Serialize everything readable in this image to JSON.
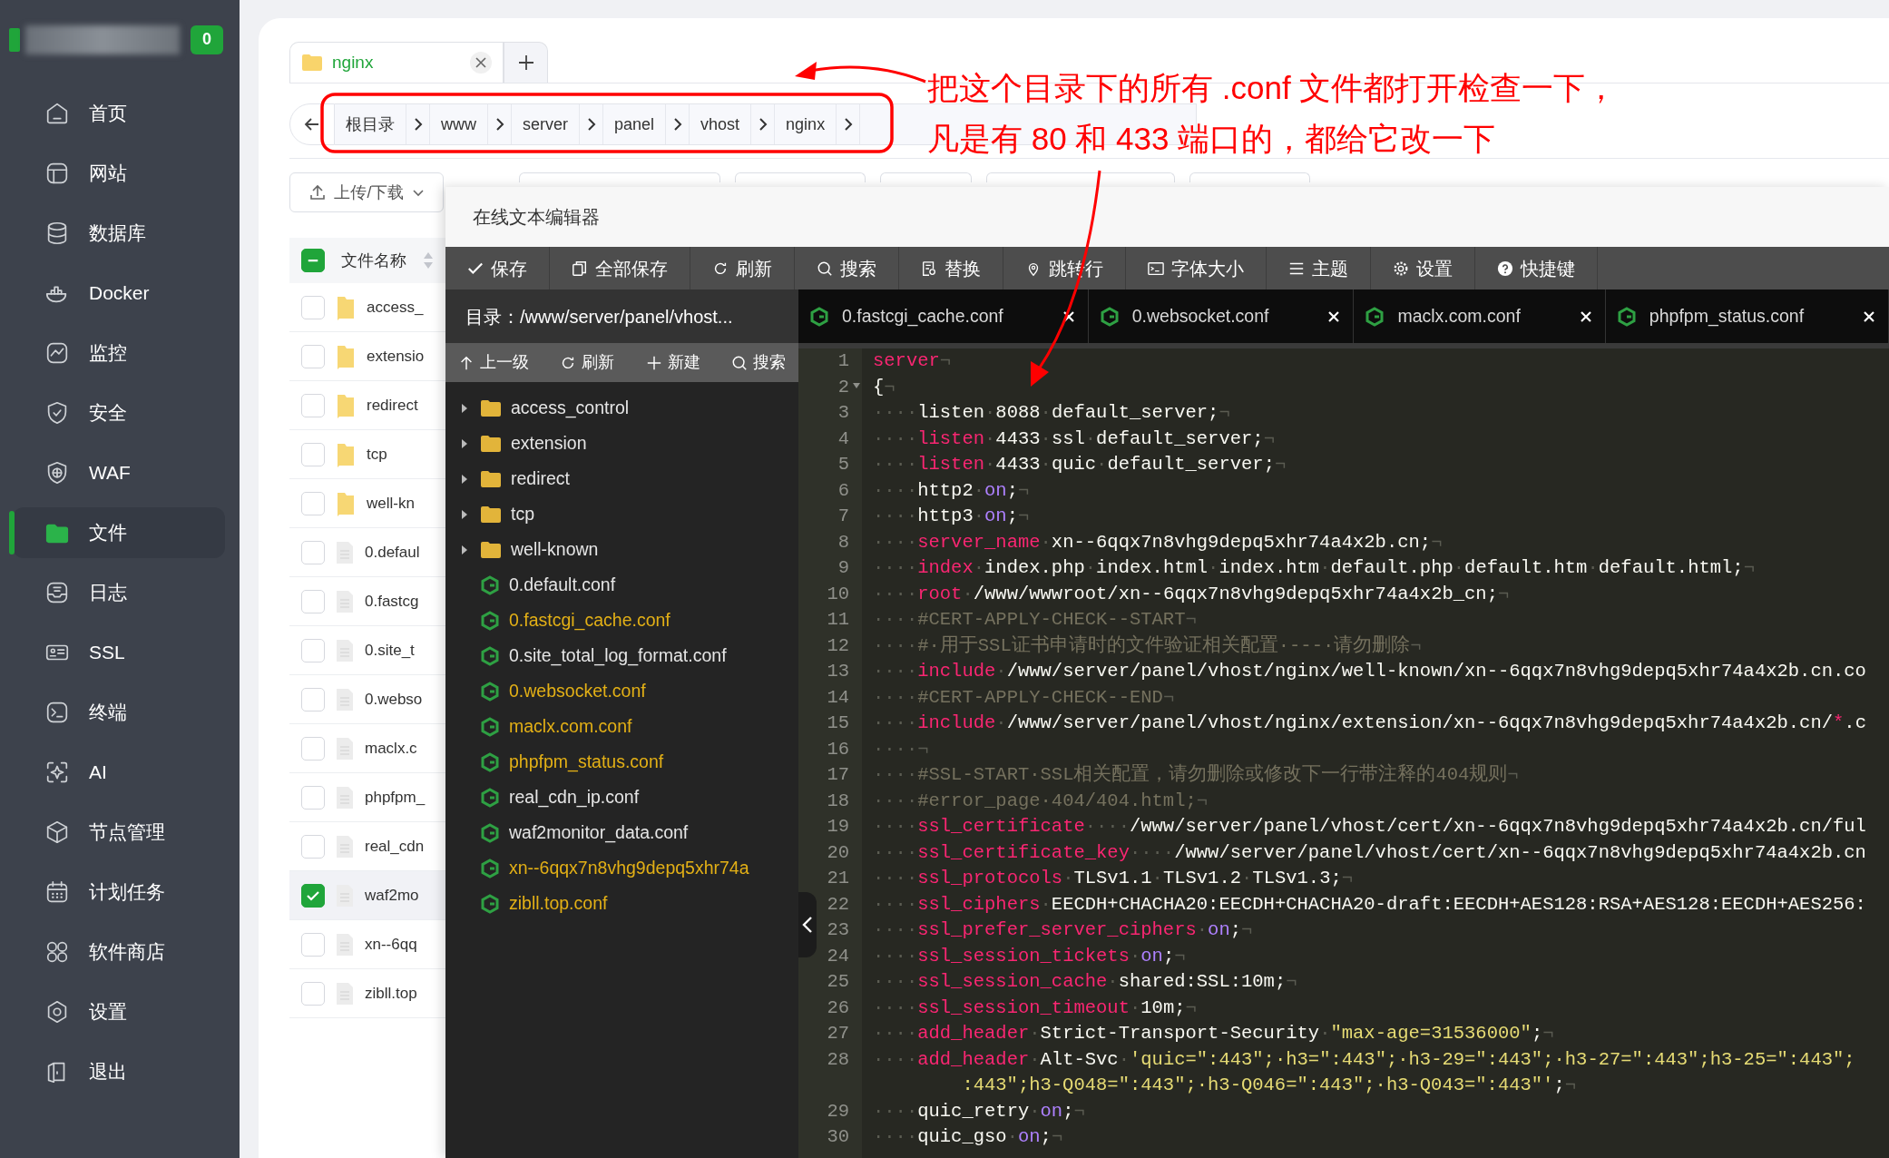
{
  "sidebar": {
    "badge": "0",
    "items": [
      {
        "label": "首页",
        "selected": false
      },
      {
        "label": "网站",
        "selected": false
      },
      {
        "label": "数据库",
        "selected": false
      },
      {
        "label": "Docker",
        "selected": false
      },
      {
        "label": "监控",
        "selected": false
      },
      {
        "label": "安全",
        "selected": false
      },
      {
        "label": "WAF",
        "selected": false
      },
      {
        "label": "文件",
        "selected": true
      },
      {
        "label": "日志",
        "selected": false
      },
      {
        "label": "SSL",
        "selected": false
      },
      {
        "label": "终端",
        "selected": false
      },
      {
        "label": "AI",
        "selected": false
      },
      {
        "label": "节点管理",
        "selected": false
      },
      {
        "label": "计划任务",
        "selected": false
      },
      {
        "label": "软件商店",
        "selected": false
      },
      {
        "label": "设置",
        "selected": false
      },
      {
        "label": "退出",
        "selected": false
      }
    ]
  },
  "file_tab": {
    "label": "nginx"
  },
  "breadcrumb": [
    "根目录",
    "www",
    "server",
    "panel",
    "vhost",
    "nginx"
  ],
  "upload_button": "上传/下载",
  "file_list": {
    "header": "文件名称",
    "header_indeterminate": true,
    "rows": [
      {
        "name": "access_",
        "kind": "folder",
        "checked": false
      },
      {
        "name": "extensio",
        "kind": "folder",
        "checked": false
      },
      {
        "name": "redirect",
        "kind": "folder",
        "checked": false
      },
      {
        "name": "tcp",
        "kind": "folder",
        "checked": false
      },
      {
        "name": "well-kn",
        "kind": "folder",
        "checked": false
      },
      {
        "name": "0.defaul",
        "kind": "file",
        "checked": false
      },
      {
        "name": "0.fastcg",
        "kind": "file",
        "checked": false
      },
      {
        "name": "0.site_t",
        "kind": "file",
        "checked": false
      },
      {
        "name": "0.webso",
        "kind": "file",
        "checked": false
      },
      {
        "name": "maclx.c",
        "kind": "file",
        "checked": false
      },
      {
        "name": "phpfpm_",
        "kind": "file",
        "checked": false
      },
      {
        "name": "real_cdn",
        "kind": "file",
        "checked": false
      },
      {
        "name": "waf2mo",
        "kind": "file",
        "checked": true
      },
      {
        "name": "xn--6qq",
        "kind": "file",
        "checked": false
      },
      {
        "name": "zibll.top",
        "kind": "file",
        "checked": false
      }
    ]
  },
  "editor": {
    "title": "在线文本编辑器",
    "toolbar": [
      {
        "label": "保存"
      },
      {
        "label": "全部保存"
      },
      {
        "label": "刷新"
      },
      {
        "label": "搜索"
      },
      {
        "label": "替换"
      },
      {
        "label": "跳转行"
      },
      {
        "label": "字体大小"
      },
      {
        "label": "主题"
      },
      {
        "label": "设置"
      },
      {
        "label": "快捷键"
      }
    ],
    "tree": {
      "path": "目录：/www/server/panel/vhost...",
      "actions": [
        {
          "label": "上一级"
        },
        {
          "label": "刷新"
        },
        {
          "label": "新建"
        },
        {
          "label": "搜索"
        }
      ],
      "items": [
        {
          "name": "access_control",
          "kind": "folder",
          "open": false
        },
        {
          "name": "extension",
          "kind": "folder",
          "open": false
        },
        {
          "name": "redirect",
          "kind": "folder",
          "open": false
        },
        {
          "name": "tcp",
          "kind": "folder",
          "open": false
        },
        {
          "name": "well-known",
          "kind": "folder",
          "open": false
        },
        {
          "name": "0.default.conf",
          "kind": "file",
          "open": false
        },
        {
          "name": "0.fastcgi_cache.conf",
          "kind": "file",
          "open": true
        },
        {
          "name": "0.site_total_log_format.conf",
          "kind": "file",
          "open": false
        },
        {
          "name": "0.websocket.conf",
          "kind": "file",
          "open": true
        },
        {
          "name": "maclx.com.conf",
          "kind": "file",
          "open": true
        },
        {
          "name": "phpfpm_status.conf",
          "kind": "file",
          "open": true
        },
        {
          "name": "real_cdn_ip.conf",
          "kind": "file",
          "open": false
        },
        {
          "name": "waf2monitor_data.conf",
          "kind": "file",
          "open": false
        },
        {
          "name": "xn--6qqx7n8vhg9depq5xhr74a",
          "kind": "file",
          "open": true
        },
        {
          "name": "zibll.top.conf",
          "kind": "file",
          "open": true
        }
      ]
    },
    "tabs": [
      {
        "label": "0.fastcgi_cache.conf"
      },
      {
        "label": "0.websocket.conf"
      },
      {
        "label": "maclx.com.conf"
      },
      {
        "label": "phpfpm_status.conf"
      }
    ],
    "lines": [
      {
        "number": "1",
        "tokens": [
          {
            "kind": "kw",
            "text": "server"
          },
          {
            "kind": "ws",
            "text": "¬"
          }
        ]
      },
      {
        "number": "2",
        "fold": true,
        "tokens": [
          {
            "kind": "txt",
            "text": "{"
          },
          {
            "kind": "ws",
            "text": "¬"
          }
        ]
      },
      {
        "number": "3",
        "tokens": [
          {
            "kind": "ws",
            "text": "····"
          },
          {
            "kind": "txt",
            "text": "listen"
          },
          {
            "kind": "ws",
            "text": "·"
          },
          {
            "kind": "txt",
            "text": "8088"
          },
          {
            "kind": "ws",
            "text": "·"
          },
          {
            "kind": "txt",
            "text": "default_server;"
          },
          {
            "kind": "ws",
            "text": "¬"
          }
        ]
      },
      {
        "number": "4",
        "tokens": [
          {
            "kind": "ws",
            "text": "····"
          },
          {
            "kind": "kw",
            "text": "listen"
          },
          {
            "kind": "ws",
            "text": "·"
          },
          {
            "kind": "txt",
            "text": "4433"
          },
          {
            "kind": "ws",
            "text": "·"
          },
          {
            "kind": "txt",
            "text": "ssl"
          },
          {
            "kind": "ws",
            "text": "·"
          },
          {
            "kind": "txt",
            "text": "default_server;"
          },
          {
            "kind": "ws",
            "text": "¬"
          }
        ]
      },
      {
        "number": "5",
        "tokens": [
          {
            "kind": "ws",
            "text": "····"
          },
          {
            "kind": "kw",
            "text": "listen"
          },
          {
            "kind": "ws",
            "text": "·"
          },
          {
            "kind": "txt",
            "text": "4433"
          },
          {
            "kind": "ws",
            "text": "·"
          },
          {
            "kind": "txt",
            "text": "quic"
          },
          {
            "kind": "ws",
            "text": "·"
          },
          {
            "kind": "txt",
            "text": "default_server;"
          },
          {
            "kind": "ws",
            "text": "¬"
          }
        ]
      },
      {
        "number": "6",
        "tokens": [
          {
            "kind": "ws",
            "text": "····"
          },
          {
            "kind": "txt",
            "text": "http2"
          },
          {
            "kind": "ws",
            "text": "·"
          },
          {
            "kind": "const",
            "text": "on"
          },
          {
            "kind": "txt",
            "text": ";"
          },
          {
            "kind": "ws",
            "text": "¬"
          }
        ]
      },
      {
        "number": "7",
        "tokens": [
          {
            "kind": "ws",
            "text": "····"
          },
          {
            "kind": "txt",
            "text": "http3"
          },
          {
            "kind": "ws",
            "text": "·"
          },
          {
            "kind": "const",
            "text": "on"
          },
          {
            "kind": "txt",
            "text": ";"
          },
          {
            "kind": "ws",
            "text": "¬"
          }
        ]
      },
      {
        "number": "8",
        "tokens": [
          {
            "kind": "ws",
            "text": "····"
          },
          {
            "kind": "kw",
            "text": "server_name"
          },
          {
            "kind": "ws",
            "text": "·"
          },
          {
            "kind": "txt",
            "text": "xn--6qqx7n8vhg9depq5xhr74a4x2b.cn;"
          },
          {
            "kind": "ws",
            "text": "¬"
          }
        ]
      },
      {
        "number": "9",
        "tokens": [
          {
            "kind": "ws",
            "text": "····"
          },
          {
            "kind": "kw",
            "text": "index"
          },
          {
            "kind": "ws",
            "text": "·"
          },
          {
            "kind": "txt",
            "text": "index.php"
          },
          {
            "kind": "ws",
            "text": "·"
          },
          {
            "kind": "txt",
            "text": "index.html"
          },
          {
            "kind": "ws",
            "text": "·"
          },
          {
            "kind": "txt",
            "text": "index.htm"
          },
          {
            "kind": "ws",
            "text": "·"
          },
          {
            "kind": "txt",
            "text": "default.php"
          },
          {
            "kind": "ws",
            "text": "·"
          },
          {
            "kind": "txt",
            "text": "default.htm"
          },
          {
            "kind": "ws",
            "text": "·"
          },
          {
            "kind": "txt",
            "text": "default.html;"
          },
          {
            "kind": "ws",
            "text": "¬"
          }
        ]
      },
      {
        "number": "10",
        "tokens": [
          {
            "kind": "ws",
            "text": "····"
          },
          {
            "kind": "kw",
            "text": "root"
          },
          {
            "kind": "ws",
            "text": "·"
          },
          {
            "kind": "txt",
            "text": "/www/wwwroot/xn--6qqx7n8vhg9depq5xhr74a4x2b_cn;"
          },
          {
            "kind": "ws",
            "text": "¬"
          }
        ]
      },
      {
        "number": "11",
        "tokens": [
          {
            "kind": "ws",
            "text": "····"
          },
          {
            "kind": "cmt",
            "text": "#CERT-APPLY-CHECK--START"
          },
          {
            "kind": "ws",
            "text": "¬"
          }
        ]
      },
      {
        "number": "12",
        "tokens": [
          {
            "kind": "ws",
            "text": "····"
          },
          {
            "kind": "cmt",
            "text": "#·用于SSL证书申请时的文件验证相关配置·---·请勿删除"
          },
          {
            "kind": "ws",
            "text": "¬"
          }
        ]
      },
      {
        "number": "13",
        "tokens": [
          {
            "kind": "ws",
            "text": "····"
          },
          {
            "kind": "kw",
            "text": "include"
          },
          {
            "kind": "ws",
            "text": "·"
          },
          {
            "kind": "txt",
            "text": "/www/server/panel/vhost/nginx/well-known/xn--6qqx7n8vhg9depq5xhr74a4x2b.cn.co"
          }
        ]
      },
      {
        "number": "14",
        "tokens": [
          {
            "kind": "ws",
            "text": "····"
          },
          {
            "kind": "cmt",
            "text": "#CERT-APPLY-CHECK--END"
          },
          {
            "kind": "ws",
            "text": "¬"
          }
        ]
      },
      {
        "number": "15",
        "tokens": [
          {
            "kind": "ws",
            "text": "····"
          },
          {
            "kind": "kw",
            "text": "include"
          },
          {
            "kind": "ws",
            "text": "·"
          },
          {
            "kind": "txt",
            "text": "/www/server/panel/vhost/nginx/extension/xn--6qqx7n8vhg9depq5xhr74a4x2b.cn/"
          },
          {
            "kind": "kw",
            "text": "*"
          },
          {
            "kind": "txt",
            "text": ".c"
          }
        ]
      },
      {
        "number": "16",
        "tokens": [
          {
            "kind": "ws",
            "text": "····¬"
          }
        ]
      },
      {
        "number": "17",
        "tokens": [
          {
            "kind": "ws",
            "text": "····"
          },
          {
            "kind": "cmt",
            "text": "#SSL-START·SSL相关配置，请勿删除或修改下一行带注释的404规则"
          },
          {
            "kind": "ws",
            "text": "¬"
          }
        ]
      },
      {
        "number": "18",
        "tokens": [
          {
            "kind": "ws",
            "text": "····"
          },
          {
            "kind": "cmt",
            "text": "#error_page·404/404.html;"
          },
          {
            "kind": "ws",
            "text": "¬"
          }
        ]
      },
      {
        "number": "19",
        "tokens": [
          {
            "kind": "ws",
            "text": "····"
          },
          {
            "kind": "kw",
            "text": "ssl_certificate"
          },
          {
            "kind": "ws",
            "text": "····"
          },
          {
            "kind": "txt",
            "text": "/www/server/panel/vhost/cert/xn--6qqx7n8vhg9depq5xhr74a4x2b.cn/ful"
          }
        ]
      },
      {
        "number": "20",
        "tokens": [
          {
            "kind": "ws",
            "text": "····"
          },
          {
            "kind": "kw",
            "text": "ssl_certificate_key"
          },
          {
            "kind": "ws",
            "text": "····"
          },
          {
            "kind": "txt",
            "text": "/www/server/panel/vhost/cert/xn--6qqx7n8vhg9depq5xhr74a4x2b.cn"
          }
        ]
      },
      {
        "number": "21",
        "tokens": [
          {
            "kind": "ws",
            "text": "····"
          },
          {
            "kind": "kw",
            "text": "ssl_protocols"
          },
          {
            "kind": "ws",
            "text": "·"
          },
          {
            "kind": "txt",
            "text": "TLSv1.1"
          },
          {
            "kind": "ws",
            "text": "·"
          },
          {
            "kind": "txt",
            "text": "TLSv1.2"
          },
          {
            "kind": "ws",
            "text": "·"
          },
          {
            "kind": "txt",
            "text": "TLSv1.3;"
          },
          {
            "kind": "ws",
            "text": "¬"
          }
        ]
      },
      {
        "number": "22",
        "tokens": [
          {
            "kind": "ws",
            "text": "····"
          },
          {
            "kind": "kw",
            "text": "ssl_ciphers"
          },
          {
            "kind": "ws",
            "text": "·"
          },
          {
            "kind": "txt",
            "text": "EECDH+CHACHA20:EECDH+CHACHA20-draft:EECDH+AES128:RSA+AES128:EECDH+AES256:"
          }
        ]
      },
      {
        "number": "23",
        "tokens": [
          {
            "kind": "ws",
            "text": "····"
          },
          {
            "kind": "kw",
            "text": "ssl_prefer_server_ciphers"
          },
          {
            "kind": "ws",
            "text": "·"
          },
          {
            "kind": "const",
            "text": "on"
          },
          {
            "kind": "txt",
            "text": ";"
          },
          {
            "kind": "ws",
            "text": "¬"
          }
        ]
      },
      {
        "number": "24",
        "tokens": [
          {
            "kind": "ws",
            "text": "····"
          },
          {
            "kind": "kw",
            "text": "ssl_session_tickets"
          },
          {
            "kind": "ws",
            "text": "·"
          },
          {
            "kind": "const",
            "text": "on"
          },
          {
            "kind": "txt",
            "text": ";"
          },
          {
            "kind": "ws",
            "text": "¬"
          }
        ]
      },
      {
        "number": "25",
        "tokens": [
          {
            "kind": "ws",
            "text": "····"
          },
          {
            "kind": "kw",
            "text": "ssl_session_cache"
          },
          {
            "kind": "ws",
            "text": "·"
          },
          {
            "kind": "txt",
            "text": "shared:SSL:10m;"
          },
          {
            "kind": "ws",
            "text": "¬"
          }
        ]
      },
      {
        "number": "26",
        "tokens": [
          {
            "kind": "ws",
            "text": "····"
          },
          {
            "kind": "kw",
            "text": "ssl_session_timeout"
          },
          {
            "kind": "ws",
            "text": "·"
          },
          {
            "kind": "txt",
            "text": "10m;"
          },
          {
            "kind": "ws",
            "text": "¬"
          }
        ]
      },
      {
        "number": "27",
        "tokens": [
          {
            "kind": "ws",
            "text": "····"
          },
          {
            "kind": "kw",
            "text": "add_header"
          },
          {
            "kind": "ws",
            "text": "·"
          },
          {
            "kind": "txt",
            "text": "Strict-Transport-Security"
          },
          {
            "kind": "ws",
            "text": "·"
          },
          {
            "kind": "str",
            "text": "\"max-age=31536000\""
          },
          {
            "kind": "txt",
            "text": ";"
          },
          {
            "kind": "ws",
            "text": "¬"
          }
        ]
      },
      {
        "number": "28",
        "tokens": [
          {
            "kind": "ws",
            "text": "····"
          },
          {
            "kind": "kw",
            "text": "add_header"
          },
          {
            "kind": "ws",
            "text": "·"
          },
          {
            "kind": "txt",
            "text": "Alt-Svc"
          },
          {
            "kind": "ws",
            "text": "·"
          },
          {
            "kind": "str",
            "text": "'quic=\":443\";·h3=\":443\";·h3-29=\":443\";·h3-27=\":443\";h3-25=\":443\";"
          }
        ],
        "wrap": [
          {
            "kind": "str",
            "text": ":443\";h3-Q048=\":443\";·h3-Q046=\":443\";·h3-Q043=\":443\"'"
          },
          {
            "kind": "txt",
            "text": ";"
          },
          {
            "kind": "ws",
            "text": "¬"
          }
        ]
      },
      {
        "number": "29",
        "tokens": [
          {
            "kind": "ws",
            "text": "····"
          },
          {
            "kind": "txt",
            "text": "quic_retry"
          },
          {
            "kind": "ws",
            "text": "·"
          },
          {
            "kind": "const",
            "text": "on"
          },
          {
            "kind": "txt",
            "text": ";"
          },
          {
            "kind": "ws",
            "text": "¬"
          }
        ]
      },
      {
        "number": "30",
        "tokens": [
          {
            "kind": "ws",
            "text": "····"
          },
          {
            "kind": "txt",
            "text": "quic_gso"
          },
          {
            "kind": "ws",
            "text": "·"
          },
          {
            "kind": "const",
            "text": "on"
          },
          {
            "kind": "txt",
            "text": ";"
          },
          {
            "kind": "ws",
            "text": "¬"
          }
        ]
      }
    ]
  },
  "annotation": {
    "lines": [
      "把这个目录下的所有 .conf 文件都打开检查一下，",
      "凡是有 80 和 433 端口的，都给它改一下"
    ]
  }
}
